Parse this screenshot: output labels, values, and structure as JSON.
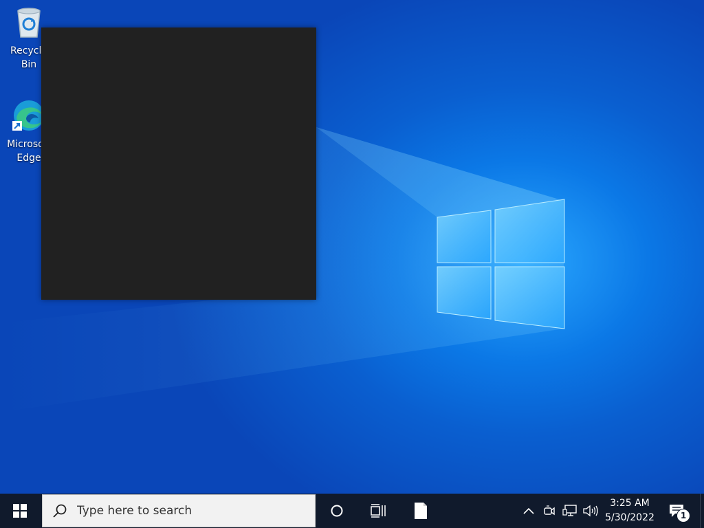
{
  "desktop": {
    "icons": [
      {
        "label": "Recycle Bin",
        "icon": "recycle-bin-icon"
      },
      {
        "label": "Microsoft Edge",
        "icon": "edge-icon"
      }
    ]
  },
  "taskbar": {
    "start_icon": "windows-logo-icon",
    "search": {
      "placeholder": "Type here to search",
      "icon": "search-icon"
    },
    "cortana_icon": "cortana-circle-icon",
    "task_view_icon": "task-view-icon",
    "file_icon": "document-icon",
    "tray": {
      "chevron_icon": "chevron-up-icon",
      "meet_icon": "meet-now-icon",
      "network_icon": "network-icon",
      "volume_icon": "volume-icon"
    },
    "clock": {
      "time": "3:25 AM",
      "date": "5/30/2022"
    },
    "notifications": {
      "icon": "action-center-icon",
      "count": "1"
    }
  },
  "colors": {
    "taskbar_bg": "#101a2c",
    "desktop_accent": "#0a78e6",
    "popup_bg": "#212121"
  }
}
